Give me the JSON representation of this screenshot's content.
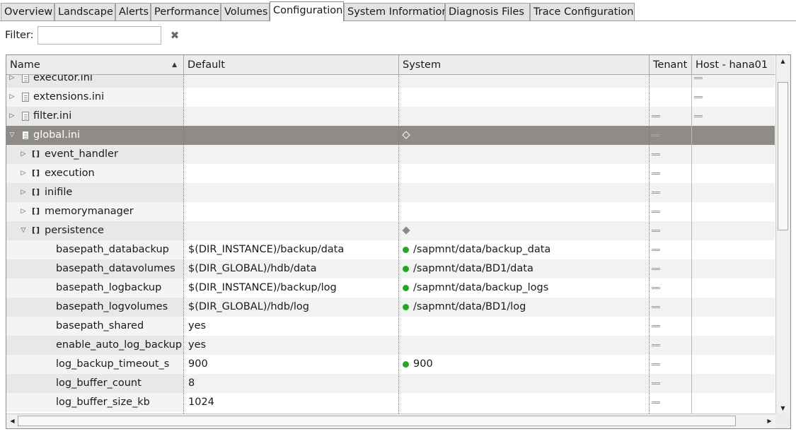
{
  "tabs": [
    {
      "label": "Overview",
      "active": false
    },
    {
      "label": "Landscape",
      "active": false
    },
    {
      "label": "Alerts",
      "active": false
    },
    {
      "label": "Performance",
      "active": false
    },
    {
      "label": "Volumes",
      "active": false
    },
    {
      "label": "Configuration",
      "active": true
    },
    {
      "label": "System Information",
      "active": false
    },
    {
      "label": "Diagnosis Files",
      "active": false
    },
    {
      "label": "Trace Configuration",
      "active": false
    }
  ],
  "filter": {
    "label": "Filter:",
    "value": "",
    "clear_icon": "clear-x-icon"
  },
  "columns": {
    "name": "Name",
    "default": "Default",
    "system": "System",
    "tenant": "Tenant",
    "host": "Host - hana01"
  },
  "sort": {
    "column": "name",
    "direction": "ascending"
  },
  "rows": [
    {
      "name": "executor.ini",
      "type": "file",
      "level": 0,
      "expanded": false,
      "default": "",
      "system": "",
      "system_marker": "none",
      "tenant_marker": false,
      "host_marker": true
    },
    {
      "name": "extensions.ini",
      "type": "file",
      "level": 0,
      "expanded": false,
      "default": "",
      "system": "",
      "system_marker": "none",
      "tenant_marker": false,
      "host_marker": true
    },
    {
      "name": "filter.ini",
      "type": "file",
      "level": 0,
      "expanded": false,
      "default": "",
      "system": "",
      "system_marker": "none",
      "tenant_marker": true,
      "host_marker": true
    },
    {
      "name": "global.ini",
      "type": "file",
      "level": 0,
      "expanded": true,
      "selected": true,
      "default": "",
      "system": "",
      "system_marker": "diamond-hollow",
      "tenant_marker": true,
      "host_marker": false
    },
    {
      "name": "event_handler",
      "type": "section",
      "level": 1,
      "expanded": false,
      "default": "",
      "system": "",
      "system_marker": "none",
      "tenant_marker": true,
      "host_marker": false
    },
    {
      "name": "execution",
      "type": "section",
      "level": 1,
      "expanded": false,
      "default": "",
      "system": "",
      "system_marker": "none",
      "tenant_marker": true,
      "host_marker": false
    },
    {
      "name": "inifile",
      "type": "section",
      "level": 1,
      "expanded": false,
      "default": "",
      "system": "",
      "system_marker": "none",
      "tenant_marker": true,
      "host_marker": false
    },
    {
      "name": "memorymanager",
      "type": "section",
      "level": 1,
      "expanded": false,
      "default": "",
      "system": "",
      "system_marker": "none",
      "tenant_marker": true,
      "host_marker": false
    },
    {
      "name": "persistence",
      "type": "section",
      "level": 1,
      "expanded": true,
      "default": "",
      "system": "",
      "system_marker": "diamond-filled",
      "tenant_marker": true,
      "host_marker": false
    },
    {
      "name": "basepath_databackup",
      "type": "param",
      "level": 2,
      "default": "$(DIR_INSTANCE)/backup/data",
      "system": "/sapmnt/data/backup_data",
      "system_marker": "dot",
      "tenant_marker": true,
      "host_marker": false
    },
    {
      "name": "basepath_datavolumes",
      "type": "param",
      "level": 2,
      "default": "$(DIR_GLOBAL)/hdb/data",
      "system": "/sapmnt/data/BD1/data",
      "system_marker": "dot",
      "tenant_marker": true,
      "host_marker": false
    },
    {
      "name": "basepath_logbackup",
      "type": "param",
      "level": 2,
      "default": "$(DIR_INSTANCE)/backup/log",
      "system": "/sapmnt/data/backup_logs",
      "system_marker": "dot",
      "tenant_marker": true,
      "host_marker": false
    },
    {
      "name": "basepath_logvolumes",
      "type": "param",
      "level": 2,
      "default": "$(DIR_GLOBAL)/hdb/log",
      "system": "/sapmnt/data/BD1/log",
      "system_marker": "dot",
      "tenant_marker": true,
      "host_marker": false
    },
    {
      "name": "basepath_shared",
      "type": "param",
      "level": 2,
      "default": "yes",
      "system": "",
      "system_marker": "none",
      "tenant_marker": true,
      "host_marker": false
    },
    {
      "name": "enable_auto_log_backup",
      "type": "param",
      "level": 2,
      "default": "yes",
      "system": "",
      "system_marker": "none",
      "tenant_marker": true,
      "host_marker": false
    },
    {
      "name": "log_backup_timeout_s",
      "type": "param",
      "level": 2,
      "default": "900",
      "system": "900",
      "system_marker": "dot",
      "tenant_marker": true,
      "host_marker": false
    },
    {
      "name": "log_buffer_count",
      "type": "param",
      "level": 2,
      "default": "8",
      "system": "",
      "system_marker": "none",
      "tenant_marker": true,
      "host_marker": false
    },
    {
      "name": "log_buffer_size_kb",
      "type": "param",
      "level": 2,
      "default": "1024",
      "system": "",
      "system_marker": "none",
      "tenant_marker": true,
      "host_marker": false
    }
  ],
  "colors": {
    "selected_row": "#8f8b86",
    "status_dot": "#22a822"
  }
}
